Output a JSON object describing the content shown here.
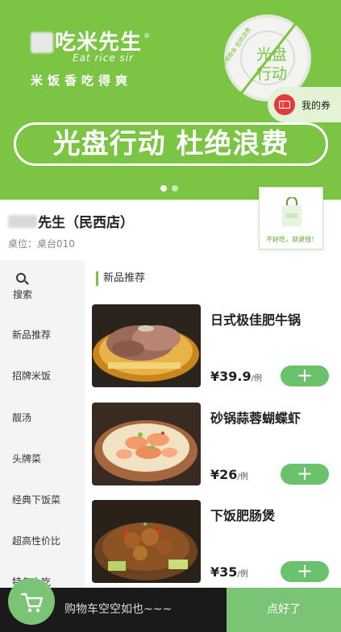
{
  "banner": {
    "brand_cn": "吃米先生",
    "brand_reg": "®",
    "brand_en": "Eat rice sir",
    "brand_slogan": "米饭香吃得爽",
    "plate_text": "光盘行动",
    "plate_curve_text": "珍惜粮食 拒绝浪费",
    "coupon_label": "我的券",
    "main_slogan": "光盘行动 杜绝浪费",
    "carousel_count": 2,
    "carousel_active": 0
  },
  "store": {
    "name": "先生（民西店）",
    "table": "桌位：桌台010",
    "card_text": "不好吃，就退钱！"
  },
  "sidebar": {
    "search_label": "搜索",
    "items": [
      {
        "label": "新品推荐"
      },
      {
        "label": "招牌米饭"
      },
      {
        "label": "靓汤"
      },
      {
        "label": "头牌菜"
      },
      {
        "label": "经典下饭菜"
      },
      {
        "label": "超高性价比"
      },
      {
        "label": "特色小吃"
      }
    ]
  },
  "section_title": "新品推荐",
  "dishes": [
    {
      "name": "日式极佳肥牛锅",
      "price": "¥39.9",
      "unit": "/例",
      "add": "+"
    },
    {
      "name": "砂锅蒜蓉蝴蝶虾",
      "price": "¥26",
      "unit": "/例",
      "add": "+"
    },
    {
      "name": "下饭肥肠煲",
      "price": "¥35",
      "unit": "/例",
      "add": "+"
    }
  ],
  "cart": {
    "empty_text": "购物车空空如也~~~",
    "checkout_label": "点好了"
  },
  "colors": {
    "brand_green": "#7cc443",
    "button_green": "#6bc26d",
    "bottom_bar": "#1a1a1a"
  }
}
